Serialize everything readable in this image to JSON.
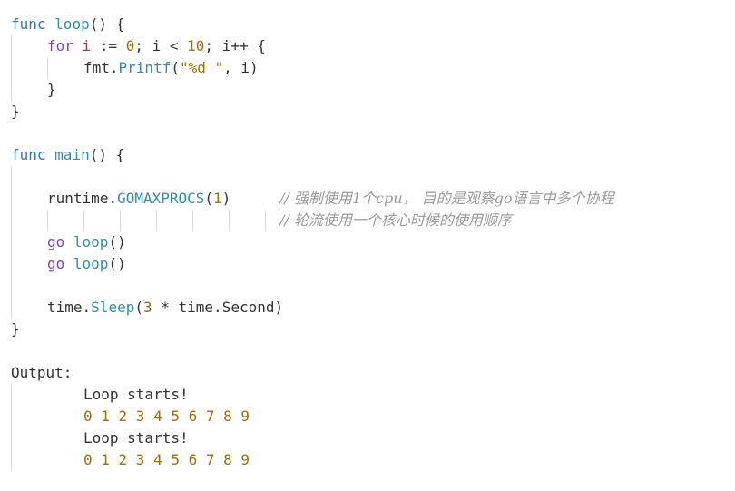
{
  "code": {
    "l1": {
      "kw": "func",
      "name": "loop",
      "rest": "() {"
    },
    "l2": {
      "kw": "for",
      "var": "i",
      "op1": " := ",
      "n0": "0",
      "mid": "; i < ",
      "n10": "10",
      "end": "; i++ {"
    },
    "l3": {
      "pkg": "fmt.",
      "fn": "Printf",
      "open": "(",
      "str": "\"%d \"",
      "close": ", i)"
    },
    "l4": {
      "text": "}"
    },
    "l5": {
      "text": "}"
    },
    "l7": {
      "kw": "func",
      "name": "main",
      "rest": "() {"
    },
    "l9": {
      "pkg": "runtime.",
      "fn": "GOMAXPROCS",
      "open": "(",
      "num": "1",
      "close": ")",
      "comment": "// 强制使用1个cpu， 目的是观察go语言中多个协程"
    },
    "l10": {
      "comment": "// 轮流使用一个核心时候的使用顺序"
    },
    "l11": {
      "kw": "go",
      "fn": "loop",
      "rest": "()"
    },
    "l12": {
      "kw": "go",
      "fn": "loop",
      "rest": "()"
    },
    "l14": {
      "pkg": "time.",
      "fn": "Sleep",
      "open": "(",
      "num": "3",
      "rest": " * time.Second)"
    },
    "l15": {
      "text": "}"
    }
  },
  "output": {
    "label": "Output:",
    "lines": [
      "Loop starts!",
      "0 1 2 3 4 5 6 7 8 9",
      "Loop starts!",
      "0 1 2 3 4 5 6 7 8 9"
    ]
  },
  "colors": {
    "keyword": "#2a78c8",
    "function": "#2a8fb0",
    "control": "#8a3ea8",
    "number": "#a36d00",
    "variable": "#b52b2b",
    "comment": "#9a9a9a"
  }
}
